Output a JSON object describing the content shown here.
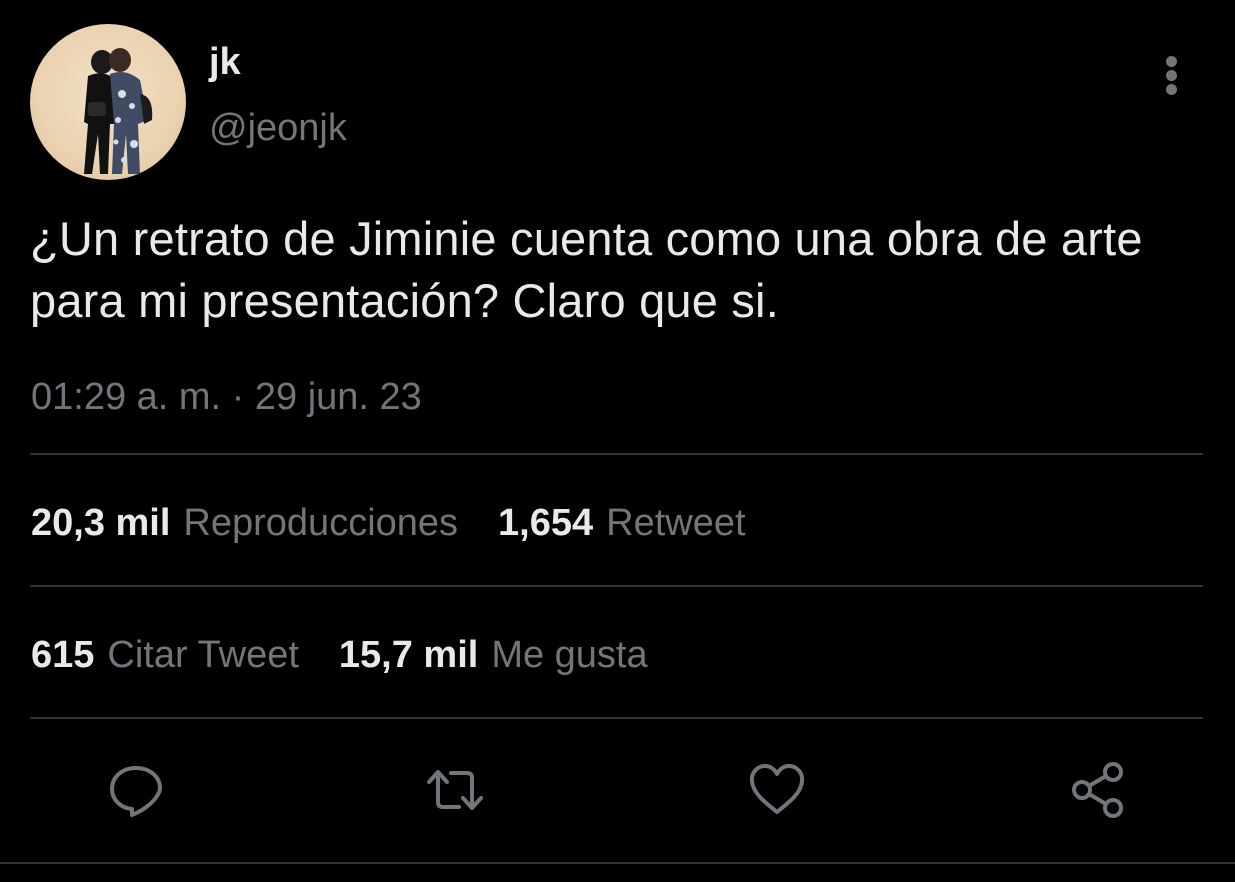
{
  "user": {
    "display_name": "jk",
    "handle": "@jeonjk",
    "avatar_alt": "profile photo"
  },
  "tweet": {
    "text": "¿Un retrato de Jiminie cuenta como una obra de arte para mi presentación? Claro que si.",
    "timestamp": "01:29 a. m. · 29 jun. 23"
  },
  "stats": {
    "views_count": "20,3 mil",
    "views_label": "Reproducciones",
    "retweets_count": "1,654",
    "retweets_label": "Retweet",
    "quotes_count": "615",
    "quotes_label": "Citar Tweet",
    "likes_count": "15,7 mil",
    "likes_label": "Me gusta"
  },
  "actions": [
    {
      "name": "reply",
      "icon": "speech-bubble-icon"
    },
    {
      "name": "retweet",
      "icon": "retweet-arrows-icon"
    },
    {
      "name": "like",
      "icon": "heart-icon"
    },
    {
      "name": "share",
      "icon": "share-nodes-icon"
    }
  ],
  "colors": {
    "background": "#000000",
    "primary_text": "#e7e9ea",
    "secondary_text": "#71767b",
    "divider": "#2f3336"
  }
}
